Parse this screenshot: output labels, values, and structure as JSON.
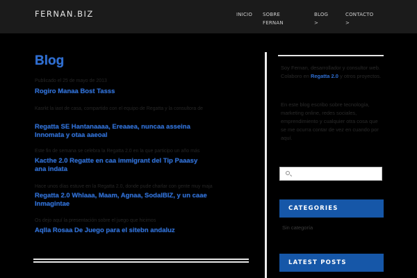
{
  "site": {
    "logo": "FERNAN.BIZ"
  },
  "nav": {
    "items": [
      {
        "label": "INICIO"
      },
      {
        "label": "SOBRE FERNAN"
      },
      {
        "label": "BLOG",
        "arrow": ">"
      },
      {
        "label": "CONTACTO",
        "arrow": ">"
      }
    ]
  },
  "main": {
    "heading": "Blog",
    "entries": [
      {
        "meta": "Publicado el 25 de mayo de 2013",
        "title_lines": [
          "Rogiro Manaa Bost Tasss"
        ]
      },
      {
        "meta": "Kasrkt la iaot de casa, compartido con el equipo de Regatta y la consultora de",
        "title_lines": [
          "Regatta SE Hantanaaaa, Ereaaea, nuncaa asseina",
          "Innomata y otaa aaeoal"
        ]
      },
      {
        "meta": "Este fin de semana se celebra la Regatta 2.0 en la que participo un año más",
        "title_lines": [
          "Kacthe 2.0 Regatte en caa immigrant del Tip Paaasy",
          "ana indata"
        ]
      },
      {
        "meta": "Hace unos días estuve en la Regatta 2.0, donde pude charlar con gente muy maja",
        "title_lines": [
          "Regatta 2.0 Whlaaa, Maam, Agnaa, SodalBIZ, y un caae",
          "Inmagintae"
        ]
      },
      {
        "meta": "Os dejo aquí la presentación sobre el juego que hicimos",
        "title_lines": [
          "Aqlla Rosaa De Juego para el sitebn andaluz"
        ]
      }
    ]
  },
  "sidebar": {
    "about": {
      "before": "Soy Fernan, desarrollador y consultor web. Colaboro en ",
      "link": "Regatta 2.0",
      "after": " y otros proyectos."
    },
    "about2": "En este blog escribo sobre tecnología, marketing online, redes sociales, emprendimiento y cualquier otra cosa que se me ocurra contar de vez en cuando por aquí.",
    "search": {
      "value": "",
      "icon": "search-icon"
    },
    "widgets": [
      {
        "title": "CATEGORIES",
        "items": [
          "Sin categoría"
        ]
      },
      {
        "title": "LATEST POSTS"
      }
    ]
  },
  "colors": {
    "page_bg": "#000000",
    "header_bg": "#1b1b1b",
    "link": "#2f6fd3",
    "widget_accent": "#1657a8"
  }
}
